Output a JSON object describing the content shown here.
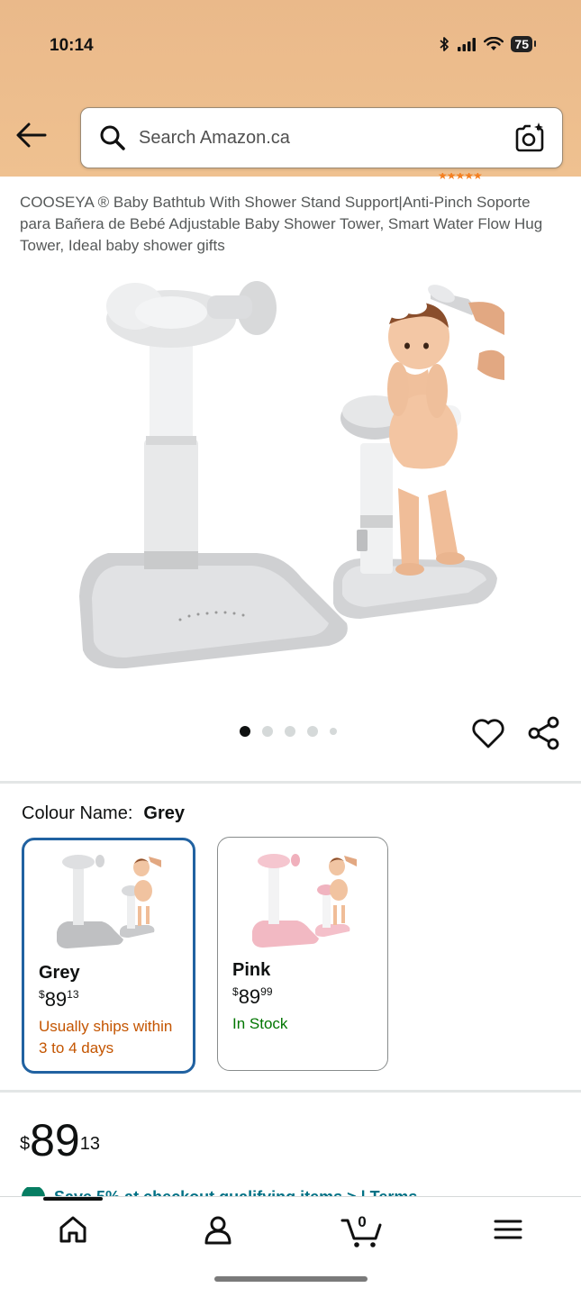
{
  "status_bar": {
    "time": "10:14",
    "battery": "75"
  },
  "search": {
    "placeholder": "Search Amazon.ca"
  },
  "product": {
    "title": "COOSEYA ® Baby Bathtub With Shower Stand Support|Anti-Pinch Soporte para Bañera de Bebé Adjustable Baby Shower Tower, Smart Water Flow Hug Tower, Ideal baby shower gifts",
    "image_count": 5,
    "active_image_index": 0
  },
  "colour": {
    "label": "Colour Name:",
    "selected": "Grey",
    "options": [
      {
        "name": "Grey",
        "price_whole": "89",
        "price_cents": "13",
        "currency": "$",
        "availability": "Usually ships within 3 to 4 days",
        "availability_color": "#c45500",
        "selected": true
      },
      {
        "name": "Pink",
        "price_whole": "89",
        "price_cents": "99",
        "currency": "$",
        "availability": "In Stock",
        "availability_color": "#007600",
        "selected": false
      }
    ]
  },
  "price": {
    "currency": "$",
    "whole": "89",
    "cents": "13"
  },
  "promo": {
    "text": "Save 5% at checkout  qualifying items >  |  Terms"
  },
  "bottom_nav": {
    "items": [
      "home-icon",
      "account-icon",
      "cart-icon",
      "menu-icon"
    ],
    "cart_count": "0"
  },
  "colors": {
    "header_bg": "#eab98a",
    "accent_blue": "#2162a1",
    "link": "#007185"
  }
}
